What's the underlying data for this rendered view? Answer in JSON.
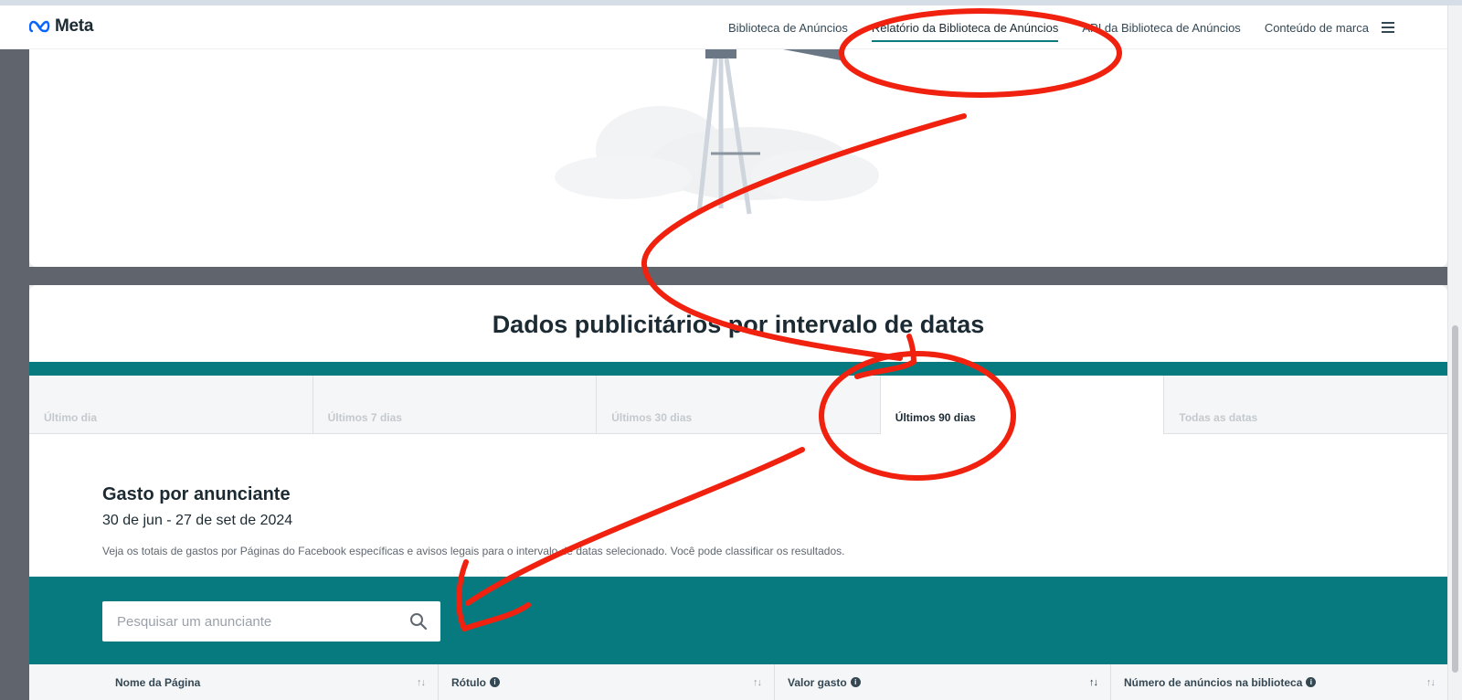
{
  "header": {
    "logo_text": "Meta",
    "nav": [
      {
        "label": "Biblioteca de Anúncios"
      },
      {
        "label": "Relatório da Biblioteca de Anúncios"
      },
      {
        "label": "API da Biblioteca de Anúncios"
      },
      {
        "label": "Conteúdo de marca"
      }
    ],
    "active_nav_index": 1
  },
  "main": {
    "section_title": "Dados publicitários por intervalo de datas",
    "tabs": [
      {
        "label": "Último dia"
      },
      {
        "label": "Últimos 7 dias"
      },
      {
        "label": "Últimos 30 dias"
      },
      {
        "label": "Últimos 90 dias"
      },
      {
        "label": "Todas as datas"
      }
    ],
    "active_tab_index": 3,
    "spend": {
      "title": "Gasto por anunciante",
      "date_range": "30 de jun - 27 de set de 2024",
      "description": "Veja os totais de gastos por Páginas do Facebook específicas e avisos legais para o intervalo de datas selecionado. Você pode classificar os resultados."
    },
    "search": {
      "placeholder": "Pesquisar um anunciante",
      "value": ""
    },
    "table": {
      "columns": [
        {
          "label": "Nome da Página",
          "info": false,
          "sorted": false
        },
        {
          "label": "Rótulo",
          "info": true,
          "sorted": false
        },
        {
          "label": "Valor gasto",
          "info": true,
          "sorted": true
        },
        {
          "label": "Número de anúncios na biblioteca",
          "info": true,
          "sorted": false
        }
      ]
    }
  },
  "colors": {
    "teal": "#077a7f",
    "annotation_red": "#f0210e",
    "sidebar_gray": "#60646d"
  },
  "icons": [
    "meta-logo-icon",
    "menu-icon",
    "search-icon",
    "info-icon",
    "sort-icon"
  ]
}
